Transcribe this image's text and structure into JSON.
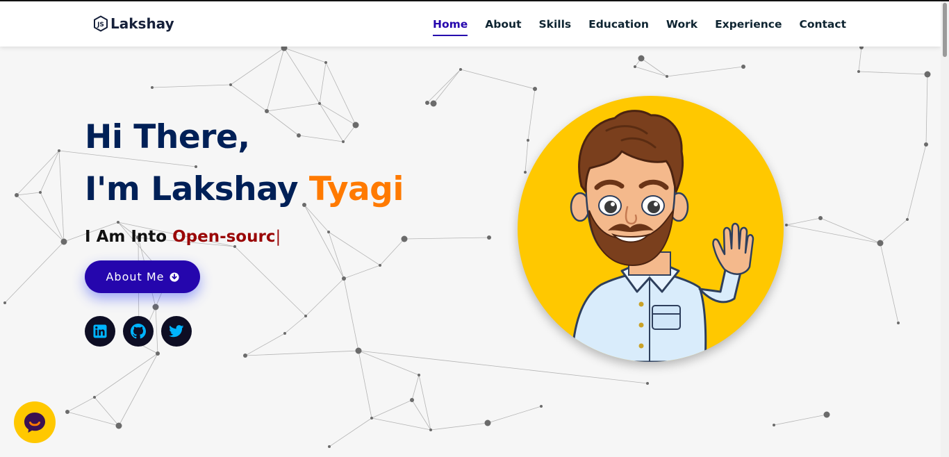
{
  "brand": {
    "icon": "js-hexagon-icon",
    "name": "Lakshay"
  },
  "nav": {
    "items": [
      "Home",
      "About",
      "Skills",
      "Education",
      "Work",
      "Experience",
      "Contact"
    ],
    "active": "Home"
  },
  "hero": {
    "greeting": "Hi There,",
    "intro_prefix": "I'm Lakshay ",
    "intro_name": "Tyagi",
    "typed_prefix": "I Am Into ",
    "typed_text": "Open-sourc",
    "typed_cursor": "|",
    "about_button": "About Me",
    "about_button_icon": "arrow-circle-down-icon"
  },
  "socials": [
    {
      "name": "linkedin",
      "icon": "linkedin-icon",
      "color": "#00b4fe"
    },
    {
      "name": "github",
      "icon": "github-icon",
      "color": "#00b4fe"
    },
    {
      "name": "twitter",
      "icon": "twitter-icon",
      "color": "#00b4fe"
    }
  ],
  "colors": {
    "heading": "#002057",
    "accent_orange": "#ff7a00",
    "typed_red": "#9a0707",
    "button_blue": "#2506ad",
    "avatar_bg": "#ffc800",
    "social_bg": "#0e0e24"
  },
  "chat_widget": {
    "icon": "chat-icon"
  },
  "avatar": {
    "alt": "cartoon-avatar"
  }
}
